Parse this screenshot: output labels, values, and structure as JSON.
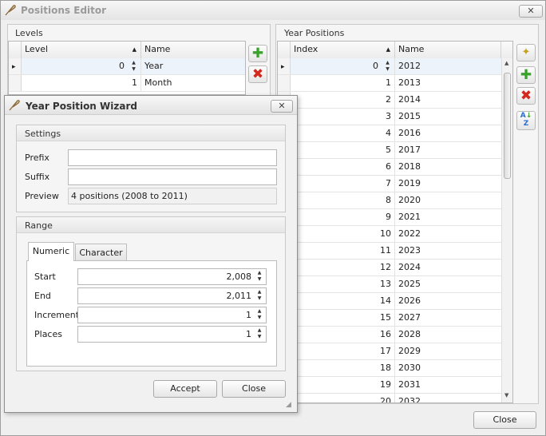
{
  "window": {
    "title": "Positions Editor",
    "close_button": "✕",
    "close_label": "Close"
  },
  "levels": {
    "header": "Levels",
    "columns": [
      "Level",
      "Name"
    ],
    "rows": [
      {
        "level": "0",
        "name": "Year"
      },
      {
        "level": "1",
        "name": "Month"
      }
    ]
  },
  "year_positions": {
    "header": "Year Positions",
    "columns": [
      "Index",
      "Name"
    ],
    "rows": [
      {
        "index": "0",
        "name": "2012"
      },
      {
        "index": "1",
        "name": "2013"
      },
      {
        "index": "2",
        "name": "2014"
      },
      {
        "index": "3",
        "name": "2015"
      },
      {
        "index": "4",
        "name": "2016"
      },
      {
        "index": "5",
        "name": "2017"
      },
      {
        "index": "6",
        "name": "2018"
      },
      {
        "index": "7",
        "name": "2019"
      },
      {
        "index": "8",
        "name": "2020"
      },
      {
        "index": "9",
        "name": "2021"
      },
      {
        "index": "10",
        "name": "2022"
      },
      {
        "index": "11",
        "name": "2023"
      },
      {
        "index": "12",
        "name": "2024"
      },
      {
        "index": "13",
        "name": "2025"
      },
      {
        "index": "14",
        "name": "2026"
      },
      {
        "index": "15",
        "name": "2027"
      },
      {
        "index": "16",
        "name": "2028"
      },
      {
        "index": "17",
        "name": "2029"
      },
      {
        "index": "18",
        "name": "2030"
      },
      {
        "index": "19",
        "name": "2031"
      },
      {
        "index": "20",
        "name": "2032"
      }
    ]
  },
  "wizard": {
    "title": "Year Position Wizard",
    "close_button": "✕",
    "settings": {
      "header": "Settings",
      "prefix_label": "Prefix",
      "prefix_value": "",
      "suffix_label": "Suffix",
      "suffix_value": "",
      "preview_label": "Preview",
      "preview_value": "4 positions (2008 to 2011)"
    },
    "range": {
      "header": "Range",
      "tabs": [
        "Numeric",
        "Character"
      ],
      "active_tab": "Numeric",
      "start_label": "Start",
      "start_value": "2,008",
      "end_label": "End",
      "end_value": "2,011",
      "increment_label": "Increment",
      "increment_value": "1",
      "places_label": "Places",
      "places_value": "1"
    },
    "accept_label": "Accept",
    "close_label": "Close"
  },
  "icons": {
    "app": "feather-icon",
    "add": "plus-icon",
    "delete": "x-icon",
    "wand": "magic-wand-icon",
    "sort": "sort-az-icon",
    "spin_up": "▲",
    "spin_down": "▼",
    "row_indicator": "▸",
    "sort_asc": "▲"
  },
  "colors": {
    "add": "#3aa22c",
    "delete": "#d4291f"
  }
}
